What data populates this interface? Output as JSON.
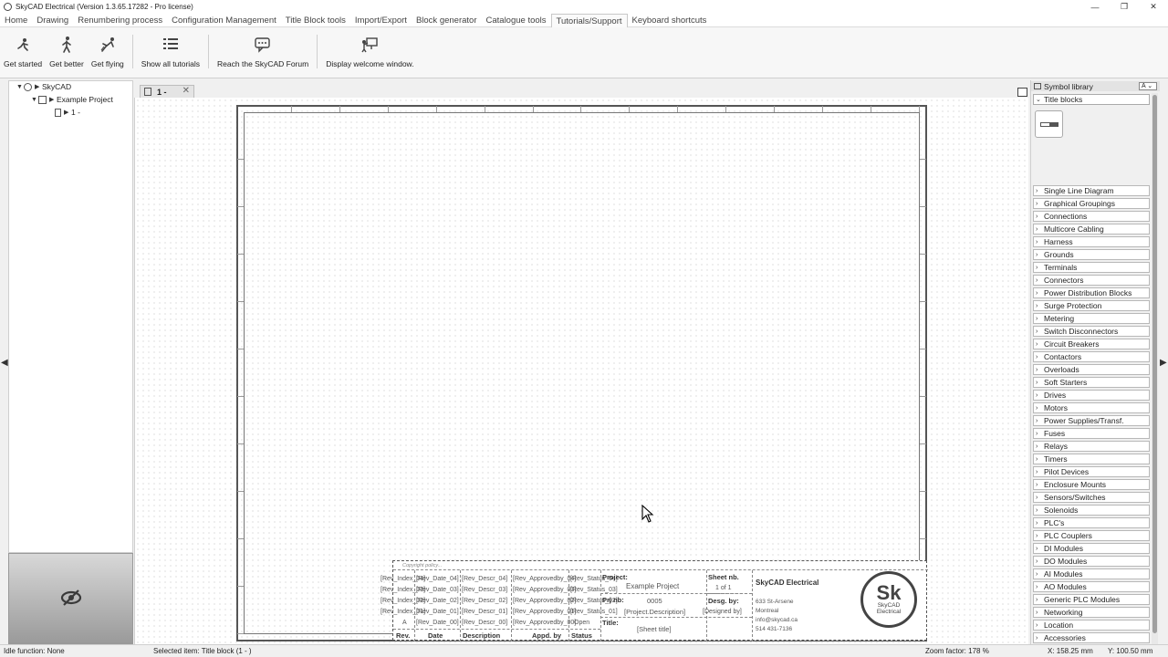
{
  "window": {
    "title": "SkyCAD Electrical (Version 1.3.65.17282 - Pro license)",
    "minimize": "—",
    "maximize": "❐",
    "close": "✕"
  },
  "menu": [
    "Home",
    "Drawing",
    "Renumbering process",
    "Configuration Management",
    "Title Block tools",
    "Import/Export",
    "Block generator",
    "Catalogue tools",
    "Tutorials/Support",
    "Keyboard shortcuts"
  ],
  "menu_active": "Tutorials/Support",
  "ribbon": {
    "get_started": "Get started",
    "get_better": "Get better",
    "get_flying": "Get flying",
    "show_all": "Show all tutorials",
    "forum": "Reach the SkyCAD Forum",
    "welcome": "Display welcome window."
  },
  "tree": {
    "root": "SkyCAD",
    "project": "Example Project",
    "sheet": "1 -"
  },
  "doc_tab": {
    "label": "1 -",
    "close": "✕"
  },
  "title_block": {
    "copyright": "Copyright policy...",
    "rev_rows": [
      {
        "index": "[Rev_Index_04]",
        "date": "[Rev_Date_04]",
        "descr": "[Rev_Descr_04]",
        "appr": "[Rev_Approvedby_04]",
        "status": "[Rev_Status_04]"
      },
      {
        "index": "[Rev_Index_03]",
        "date": "[Rev_Date_03]",
        "descr": "[Rev_Descr_03]",
        "appr": "[Rev_Approvedby_03]",
        "status": "[Rev_Status_03]"
      },
      {
        "index": "[Rev_Index_02]",
        "date": "[Rev_Date_02]",
        "descr": "[Rev_Descr_02]",
        "appr": "[Rev_Approvedby_02]",
        "status": "[Rev_Status_02]"
      },
      {
        "index": "[Rev_Index_01]",
        "date": "[Rev_Date_01]",
        "descr": "[Rev_Descr_01]",
        "appr": "[Rev_Approvedby_01]",
        "status": "[Rev_Status_01]"
      },
      {
        "index": "A",
        "date": "[Rev_Date_00]",
        "descr": "[Rev_Descr_00]",
        "appr": "[Rev_Approvedby_00]",
        "status": "Open"
      }
    ],
    "hdr_rev": "Rev.",
    "hdr_date": "Date",
    "hdr_descr": "Description",
    "hdr_appd": "Appd. by",
    "hdr_status": "Status",
    "project_lbl": "Project:",
    "project_val": "Example Project",
    "prj_nb_lbl": "Prj nb:",
    "prj_nb_val": "0005",
    "project_descr": "[Project.Description]",
    "title_lbl": "Title:",
    "title_val": "[Sheet title]",
    "sheet_nb_lbl": "Sheet nb.",
    "sheet_nb_val": "1  of  1",
    "desg_lbl": "Desg. by:",
    "desg_val": "[Designed by]",
    "company": "SkyCAD Electrical",
    "addr1": "633 St-Arsene",
    "addr2": "Montreal",
    "email": "info@skycad.ca",
    "phone": "514 431-7136",
    "logo_big": "Sk",
    "logo_line1": "SkyCAD",
    "logo_line2": "Electrical"
  },
  "symbol_library": {
    "title": "Symbol library",
    "dropdown": "A",
    "section": "Title blocks",
    "categories": [
      "Single Line Diagram",
      "Graphical Groupings",
      "Connections",
      "Multicore Cabling",
      "Harness",
      "Grounds",
      "Terminals",
      "Connectors",
      "Power Distribution Blocks",
      "Surge Protection",
      "Metering",
      "Switch Disconnectors",
      "Circuit Breakers",
      "Contactors",
      "Overloads",
      "Soft Starters",
      "Drives",
      "Motors",
      "Power Supplies/Transf.",
      "Fuses",
      "Relays",
      "Timers",
      "Pilot Devices",
      "Enclosure Mounts",
      "Sensors/Switches",
      "Solenoids",
      "PLC's",
      "PLC Couplers",
      "DI Modules",
      "DO Modules",
      "AI Modules",
      "AO Modules",
      "Generic PLC Modules",
      "Networking",
      "Location",
      "Accessories"
    ]
  },
  "status": {
    "idle": "Idle function: None",
    "selected": "Selected item: Title block (1 - )",
    "zoom": "Zoom factor: 178 %",
    "x": "X: 158.25 mm",
    "y": "Y: 100.50 mm"
  },
  "icons": {
    "arrow_left": "◀",
    "arrow_right": "▶",
    "tree_open": "▼",
    "tree_closed": "▶",
    "chev_right": "›",
    "chev_down": "⌄"
  }
}
